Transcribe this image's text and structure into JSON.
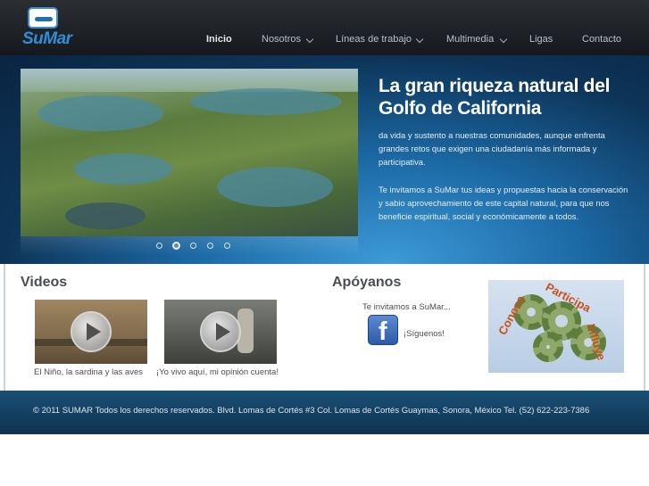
{
  "logo": {
    "text": "SuMar"
  },
  "nav": {
    "items": [
      {
        "label": "Inicio",
        "active": true
      },
      {
        "label": "Nosotros",
        "dropdown": true
      },
      {
        "label": "Líneas de trabajo",
        "dropdown": true
      },
      {
        "label": "Multimedia",
        "dropdown": true
      },
      {
        "label": "Ligas"
      },
      {
        "label": "Contacto"
      }
    ]
  },
  "hero": {
    "title": "La gran riqueza natural del Golfo de California",
    "paragraphs": [
      "da vida y sustento a nuestras comunidades, aunque enfrenta grandes retos que exigen una ciudadanía más informada y participativa.",
      "Te invitamos a SuMar tus ideas y propuestas hacia la conservación y sabio aprovechamiento de este capital natural, para que nos beneficie espiritual, social y económicamente a todos."
    ],
    "slider": {
      "total_slides": 5,
      "active_slide": 2
    }
  },
  "videos": {
    "heading": "Videos",
    "items": [
      {
        "caption": "El Niño, la sardina y las aves"
      },
      {
        "caption": "¡Yo vivo aquí, mi opinión cuenta!"
      }
    ]
  },
  "apoyanos": {
    "heading": "Apóyanos",
    "intro": "Te invitamos a SuMar...",
    "facebook_label": "¡Síguenos!"
  },
  "banner": {
    "words": [
      "Conoce",
      "Participa",
      "Influye"
    ]
  },
  "footer": {
    "text": "© 2011 SUMAR Todos los derechos reservados. Blvd. Lomas de Cortés #3 Col. Lomas de Cortés Guaymas, Sonora, México Tel. (52) 622-223-7386"
  },
  "colors": {
    "header_bg": "#1c1f23",
    "accent_blue": "#2f8fd6",
    "footer_bg": "#153f60",
    "banner_text": "#c9501d"
  },
  "icons": {
    "play": "play-icon",
    "facebook": "facebook-icon",
    "chevron": "chevron-down-icon"
  }
}
